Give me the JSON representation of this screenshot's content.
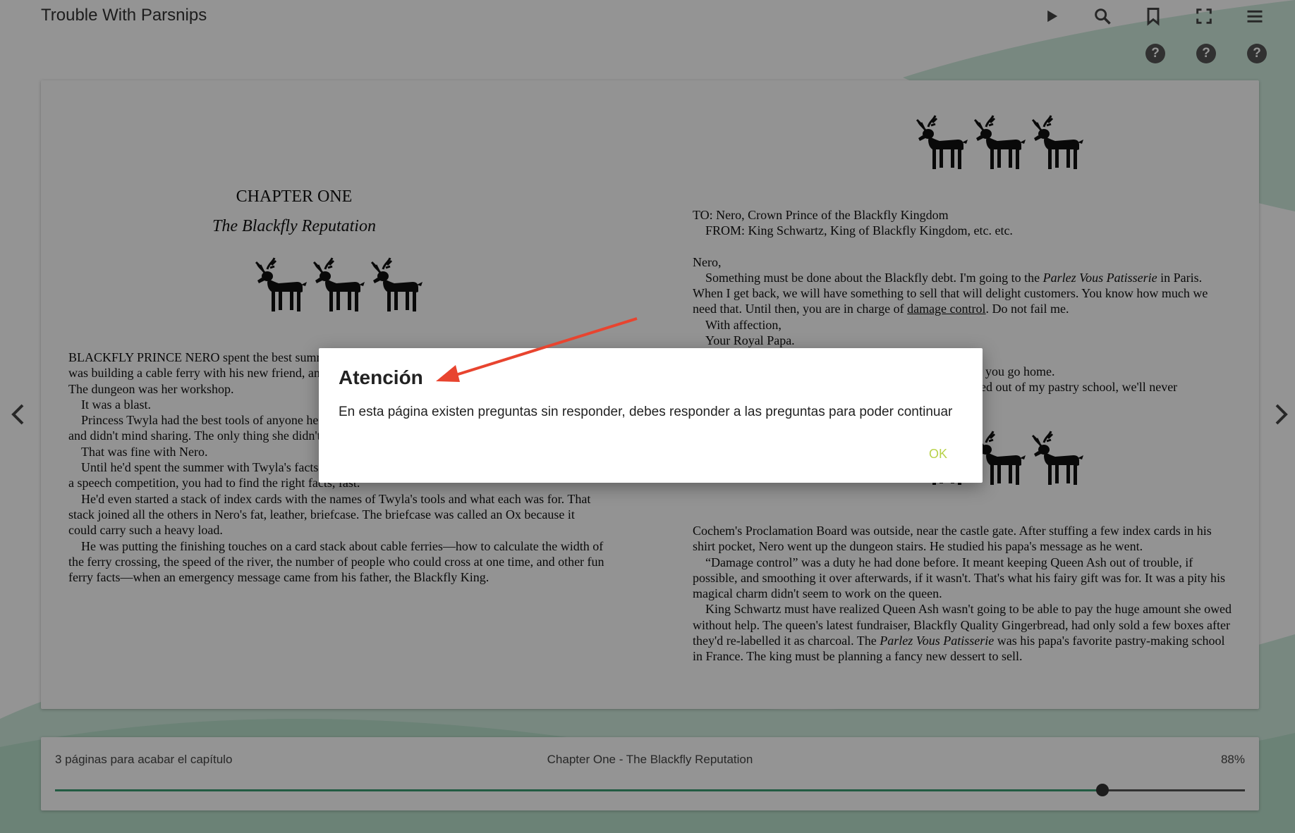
{
  "app": {
    "title": "Trouble With Parsnips"
  },
  "toolbar": {
    "icons": [
      "play-icon",
      "search-icon",
      "bookmark-icon",
      "fullscreen-icon",
      "menu-icon"
    ],
    "help_glyph": "?"
  },
  "colors": {
    "accent": "#3b9e73",
    "ok_button": "#b8d24a",
    "arrow": "#e8442f"
  },
  "left_page": {
    "chapter_title": "CHAPTER ONE",
    "chapter_subtitle": "The Blackfly Reputation",
    "paragraphs": [
      "BLACKFLY PRINCE NERO spent the best summer of his life in the castle dungeon. His friend Twyla was building a cable ferry with his new friend, and he was helping. Twyla was the fairy of the family. The dungeon was her workshop.",
      "It was a blast.",
      "Princess Twyla had the best tools of anyone he knew. She knew what each was for, how to use them, and didn't mind sharing. The only thing she didn't do was speak.",
      "That was fine with Nero.",
      "Until he'd spent the summer with Twyla's facts, he'd never known there were so many things to do. In a speech competition, you had to find the right facts, fast.",
      "He'd even started a stack of index cards with the names of Twyla's tools and what each was for. That stack joined all the others in Nero's fat, leather, briefcase. The briefcase was called an Ox because it could carry such a heavy load.",
      "He was putting the finishing touches on a card stack about cable ferries—how to calculate the width of the ferry crossing, the speed of the river, the number of people who could cross at one time, and other fun ferry facts—when an emergency message came from his father, the Blackfly King."
    ]
  },
  "right_page": {
    "to_line": "TO: Nero, Crown Prince of the Blackfly Kingdom",
    "from_line": "FROM: King Schwartz, King of Blackfly Kingdom, etc. etc.",
    "greeting": "Nero,",
    "letter_a": "Something must be done about the Blackfly debt. I'm going to the ",
    "letter_a_it": "Parlez Vous Patisserie",
    "letter_b": " in Paris. When I get back, we will have something to sell that will delight customers. You know how much we need that. Until then, you are in charge of ",
    "letter_link": "damage control",
    "letter_c": ". Do not fail me.",
    "sign1": "With affection,",
    "sign2": "Your Royal Papa.",
    "mid1": "you go home.",
    "mid2": "ed out of my pastry school, we'll never",
    "p1": "Cochem's Proclamation Board was outside, near the castle gate. After stuffing a few index cards in his shirt pocket, Nero went up the dungeon stairs. He studied his papa's message as he went.",
    "p2": "“Damage control” was a duty he had done before. It meant keeping Queen Ash out of trouble, if possible, and smoothing it over afterwards, if it wasn't. That's what his fairy gift was for. It was a pity his magical charm didn't seem to work on the queen.",
    "p3a": "King Schwartz must have realized Queen Ash wasn't going to be able to pay the huge amount she owed without help. The queen's latest fundraiser, Blackfly Quality Gingerbread, had only sold a few boxes after they'd re-labelled it as charcoal. The ",
    "p3_it": "Parlez Vous Patisserie",
    "p3b": " was his papa's favorite pastry-making school in France. The king must be planning a fancy new dessert to sell."
  },
  "progress": {
    "remaining_label": "3 páginas para acabar el capítulo",
    "chapter_label": "Chapter One - The Blackfly Reputation",
    "percent_label": "88%",
    "fraction": 0.88
  },
  "dialog": {
    "title": "Atención",
    "message": "En esta página existen preguntas sin responder, debes responder a las preguntas para poder continuar",
    "ok_label": "OK"
  }
}
